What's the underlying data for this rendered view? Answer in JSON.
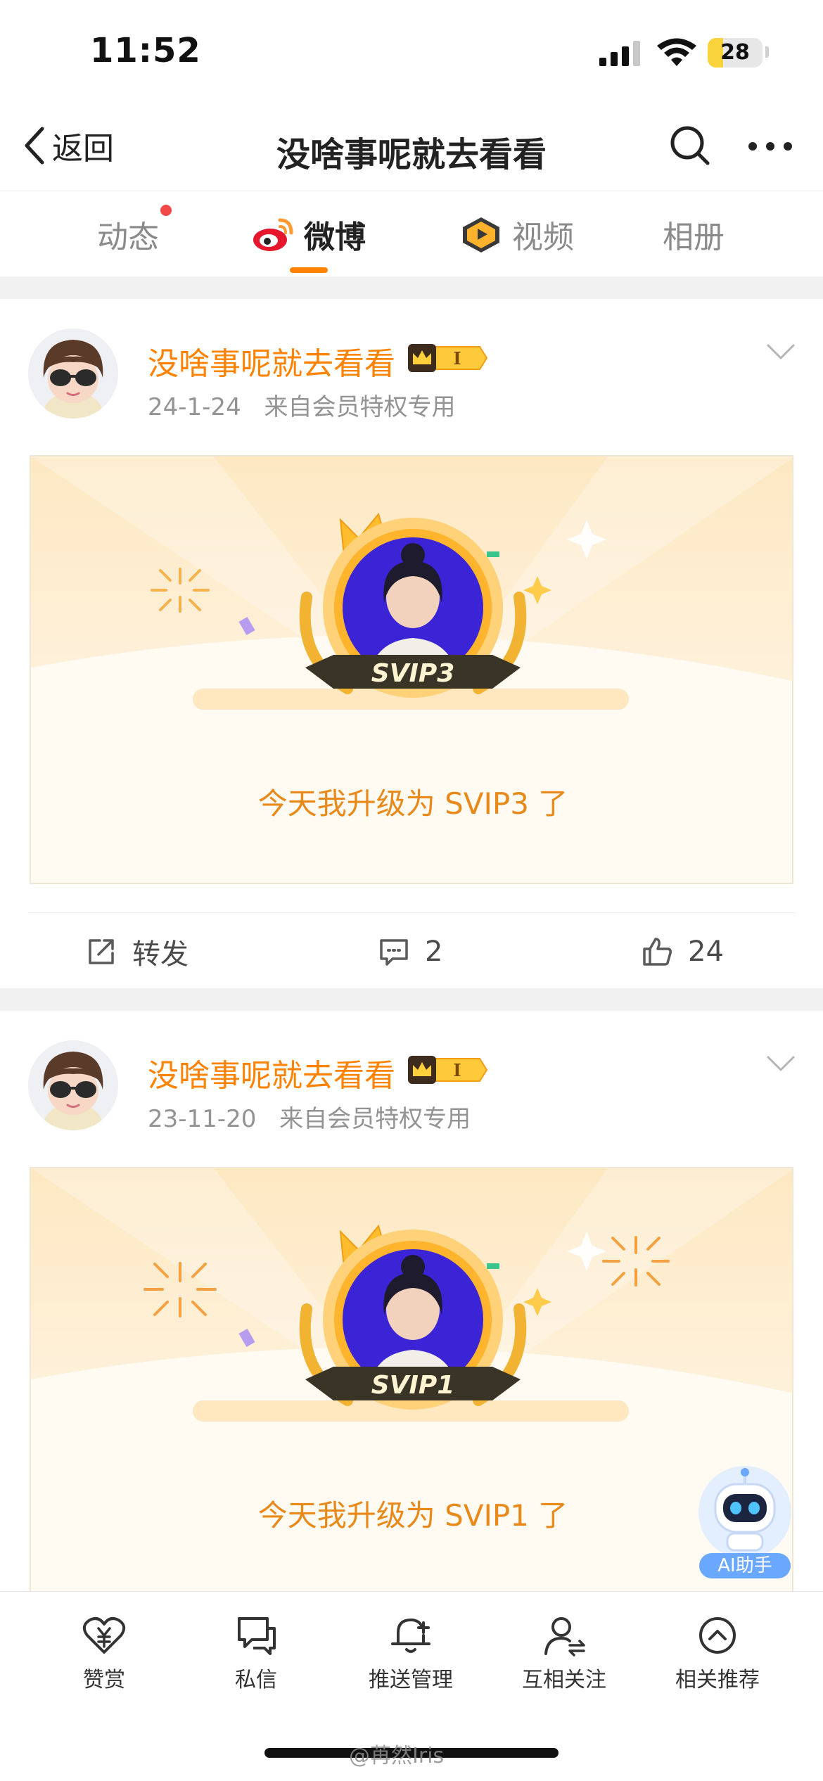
{
  "status_bar": {
    "time": "11:52",
    "battery_percent": "28",
    "battery_level": 0.28,
    "icons": [
      "cellular-signal-icon",
      "wifi-icon",
      "battery-icon"
    ]
  },
  "nav": {
    "back_label": "返回",
    "title": "没啥事呢就去看看",
    "icons": [
      "chevron-left-icon",
      "search-icon",
      "more-icon"
    ]
  },
  "tabs": [
    {
      "label": "动态",
      "has_badge": true
    },
    {
      "label": "微博",
      "active": true,
      "icon": "weibo-logo-icon"
    },
    {
      "label": "视频",
      "icon": "video-badge-icon"
    },
    {
      "label": "相册"
    }
  ],
  "posts": [
    {
      "author": "没啥事呢就去看看",
      "vip_badge_text": "I",
      "date": "24-1-24",
      "source": "来自会员特权专用",
      "card_rank": "SVIP3",
      "card_caption": "今天我升级为 SVIP3 了",
      "actions": {
        "repost_label": "转发",
        "comments": "2",
        "likes": "24"
      }
    },
    {
      "author": "没啥事呢就去看看",
      "vip_badge_text": "I",
      "date": "23-11-20",
      "source": "来自会员特权专用",
      "card_rank": "SVIP1",
      "card_caption": "今天我升级为 SVIP1 了"
    }
  ],
  "ai_helper": {
    "label": "AI助手"
  },
  "bottom_bar": [
    {
      "label": "赞赏",
      "icon": "heart-yuan-icon"
    },
    {
      "label": "私信",
      "icon": "message-icon"
    },
    {
      "label": "推送管理",
      "icon": "bell-plus-icon"
    },
    {
      "label": "互相关注",
      "icon": "mutual-follow-icon"
    },
    {
      "label": "相关推荐",
      "icon": "chevron-up-circle-icon"
    }
  ],
  "watermark": "@苒然Iris",
  "colors": {
    "accent": "#ff8200",
    "vip_orange": "#ff8200",
    "badge_red": "#f14848",
    "card_gold": "#e8891a"
  }
}
